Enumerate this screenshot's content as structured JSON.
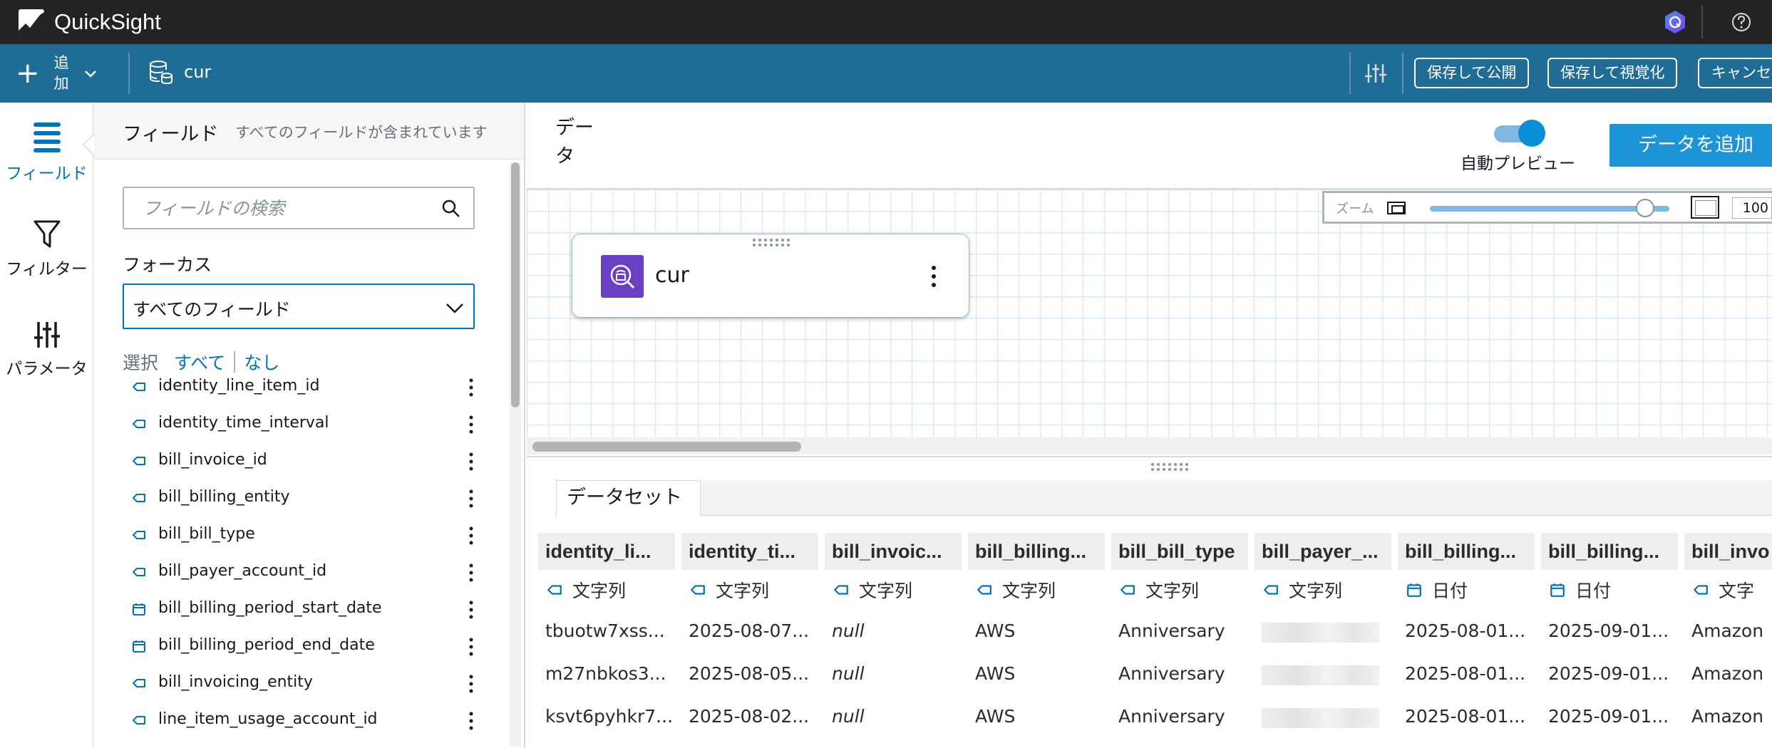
{
  "app": {
    "name": "QuickSight"
  },
  "toolbar": {
    "add_label": "追加",
    "dataset_name": "cur",
    "buttons": {
      "save_publish": "保存して公開",
      "save_visualize": "保存して視覚化",
      "cancel": "キャンセ"
    }
  },
  "leftnav": {
    "items": [
      {
        "label": "フィールド"
      },
      {
        "label": "フィルター"
      },
      {
        "label": "パラメータ"
      }
    ]
  },
  "fields_panel": {
    "title": "フィールド",
    "subtitle": "すべてのフィールドが含まれています",
    "search_placeholder": "フィールドの検索",
    "focus_label": "フォーカス",
    "focus_value": "すべてのフィールド",
    "select_label": "選択",
    "select_all": "すべて",
    "select_none": "なし",
    "fields": [
      {
        "name": "identity_line_item_id",
        "type": "string"
      },
      {
        "name": "identity_time_interval",
        "type": "string"
      },
      {
        "name": "bill_invoice_id",
        "type": "string"
      },
      {
        "name": "bill_billing_entity",
        "type": "string"
      },
      {
        "name": "bill_bill_type",
        "type": "string"
      },
      {
        "name": "bill_payer_account_id",
        "type": "string"
      },
      {
        "name": "bill_billing_period_start_date",
        "type": "date"
      },
      {
        "name": "bill_billing_period_end_date",
        "type": "date"
      },
      {
        "name": "bill_invoicing_entity",
        "type": "string"
      },
      {
        "name": "line_item_usage_account_id",
        "type": "string"
      }
    ]
  },
  "data_area": {
    "title": "データ",
    "auto_preview_label": "自動プレビュー",
    "add_data_button": "データを追加",
    "zoom": {
      "label": "ズーム",
      "value": "100",
      "level_fraction": 0.9
    },
    "node": {
      "name": "cur"
    }
  },
  "preview": {
    "tab_label": "データセット",
    "columns": [
      {
        "header": "identity_li...",
        "type": "文字列",
        "type_kind": "string",
        "cells": [
          "tbuotw7xss...",
          "m27nbkos3...",
          "ksvt6pyhkr7..."
        ]
      },
      {
        "header": "identity_ti...",
        "type": "文字列",
        "type_kind": "string",
        "cells": [
          "2025-08-07...",
          "2025-08-05...",
          "2025-08-02..."
        ]
      },
      {
        "header": "bill_invoic...",
        "type": "文字列",
        "type_kind": "string",
        "cells": [
          "null",
          "null",
          "null"
        ]
      },
      {
        "header": "bill_billing...",
        "type": "文字列",
        "type_kind": "string",
        "cells": [
          "AWS",
          "AWS",
          "AWS"
        ]
      },
      {
        "header": "bill_bill_type",
        "type": "文字列",
        "type_kind": "string",
        "cells": [
          "Anniversary",
          "Anniversary",
          "Anniversary"
        ]
      },
      {
        "header": "bill_payer_...",
        "type": "文字列",
        "type_kind": "string",
        "cells": [
          "",
          "",
          ""
        ]
      },
      {
        "header": "bill_billing...",
        "type": "日付",
        "type_kind": "date",
        "cells": [
          "2025-08-01...",
          "2025-08-01...",
          "2025-08-01..."
        ]
      },
      {
        "header": "bill_billing...",
        "type": "日付",
        "type_kind": "date",
        "cells": [
          "2025-09-01...",
          "2025-09-01...",
          "2025-09-01..."
        ]
      },
      {
        "header": "bill_invo",
        "type": "文字",
        "type_kind": "string",
        "cells": [
          "Amazon",
          "Amazon",
          "Amazon"
        ]
      }
    ]
  },
  "colors": {
    "topbar": "#232323",
    "toolbar": "#1f6c96",
    "accent": "#0073bb",
    "primary_button": "#1b95d8",
    "node_icon": "#6a3fc4"
  }
}
